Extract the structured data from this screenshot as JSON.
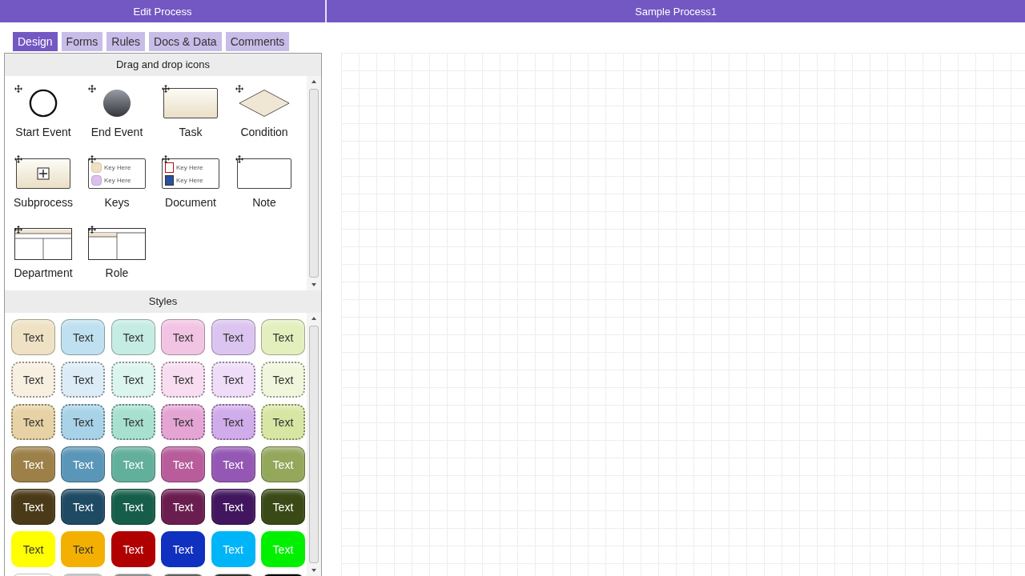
{
  "header": {
    "left_title": "Edit Process",
    "right_title": "Sample Process1"
  },
  "tabs": [
    {
      "label": "Design",
      "selected": true
    },
    {
      "label": "Forms",
      "selected": false
    },
    {
      "label": "Rules",
      "selected": false
    },
    {
      "label": "Docs & Data",
      "selected": false
    },
    {
      "label": "Comments",
      "selected": false
    }
  ],
  "icons_section": {
    "title": "Drag and drop icons",
    "items": [
      {
        "kind": "start-event",
        "label": "Start Event"
      },
      {
        "kind": "end-event",
        "label": "End Event"
      },
      {
        "kind": "task",
        "label": "Task"
      },
      {
        "kind": "condition",
        "label": "Condition"
      },
      {
        "kind": "subprocess",
        "label": "Subprocess"
      },
      {
        "kind": "keys",
        "label": "Keys",
        "keys": [
          "Key Here",
          "Key Here"
        ]
      },
      {
        "kind": "document",
        "label": "Document",
        "keys": [
          "Key Here",
          "Key Here"
        ]
      },
      {
        "kind": "note",
        "label": "Note"
      },
      {
        "kind": "department",
        "label": "Department"
      },
      {
        "kind": "role",
        "label": "Role"
      }
    ]
  },
  "styles_section": {
    "title": "Styles",
    "rows": [
      {
        "kind": "light",
        "items": [
          {
            "text": "Text",
            "color": "#efe2c4"
          },
          {
            "text": "Text",
            "color": "#bfe0f0"
          },
          {
            "text": "Text",
            "color": "#c4ece2"
          },
          {
            "text": "Text",
            "color": "#f2c4e4"
          },
          {
            "text": "Text",
            "color": "#dcc4f0"
          },
          {
            "text": "Text",
            "color": "#e4efbe"
          }
        ]
      },
      {
        "kind": "pale-dotted",
        "items": [
          {
            "text": "Text",
            "color": "#f7efe0"
          },
          {
            "text": "Text",
            "color": "#dcecf6"
          },
          {
            "text": "Text",
            "color": "#dcf4ee"
          },
          {
            "text": "Text",
            "color": "#f8dcf0"
          },
          {
            "text": "Text",
            "color": "#eedcf8"
          },
          {
            "text": "Text",
            "color": "#f0f6dc"
          }
        ]
      },
      {
        "kind": "dotted",
        "items": [
          {
            "text": "Text",
            "color": "#e6d2a4"
          },
          {
            "text": "Text",
            "color": "#a8d2e8"
          },
          {
            "text": "Text",
            "color": "#a8e0d0"
          },
          {
            "text": "Text",
            "color": "#e4a4d4"
          },
          {
            "text": "Text",
            "color": "#d0acea"
          },
          {
            "text": "Text",
            "color": "#d8e6a4"
          }
        ]
      },
      {
        "kind": "medium",
        "items": [
          {
            "text": "Text",
            "color": "#9c8048"
          },
          {
            "text": "Text",
            "color": "#5a96b8"
          },
          {
            "text": "Text",
            "color": "#62b09c"
          },
          {
            "text": "Text",
            "color": "#b85c9c"
          },
          {
            "text": "Text",
            "color": "#9458b4"
          },
          {
            "text": "Text",
            "color": "#94a85c"
          }
        ]
      },
      {
        "kind": "dark",
        "items": [
          {
            "text": "Text",
            "color": "#4a3a18"
          },
          {
            "text": "Text",
            "color": "#1e4a64"
          },
          {
            "text": "Text",
            "color": "#165e4a"
          },
          {
            "text": "Text",
            "color": "#6a1e50"
          },
          {
            "text": "Text",
            "color": "#42165e"
          },
          {
            "text": "Text",
            "color": "#3a4a16"
          }
        ]
      },
      {
        "kind": "bright",
        "items": [
          {
            "text": "Text",
            "color": "#ffff00"
          },
          {
            "text": "Text",
            "color": "#f4b000"
          },
          {
            "text": "Text",
            "color": "#b00000"
          },
          {
            "text": "Text",
            "color": "#1030c0"
          },
          {
            "text": "Text",
            "color": "#00b4f8"
          },
          {
            "text": "Text",
            "color": "#00f000"
          }
        ]
      },
      {
        "kind": "gray",
        "items": [
          {
            "color": "#ffffff"
          },
          {
            "color": "#c8c8c8"
          },
          {
            "color": "#909090"
          },
          {
            "color": "#606060"
          },
          {
            "color": "#303030"
          },
          {
            "color": "#000000"
          }
        ]
      }
    ]
  }
}
